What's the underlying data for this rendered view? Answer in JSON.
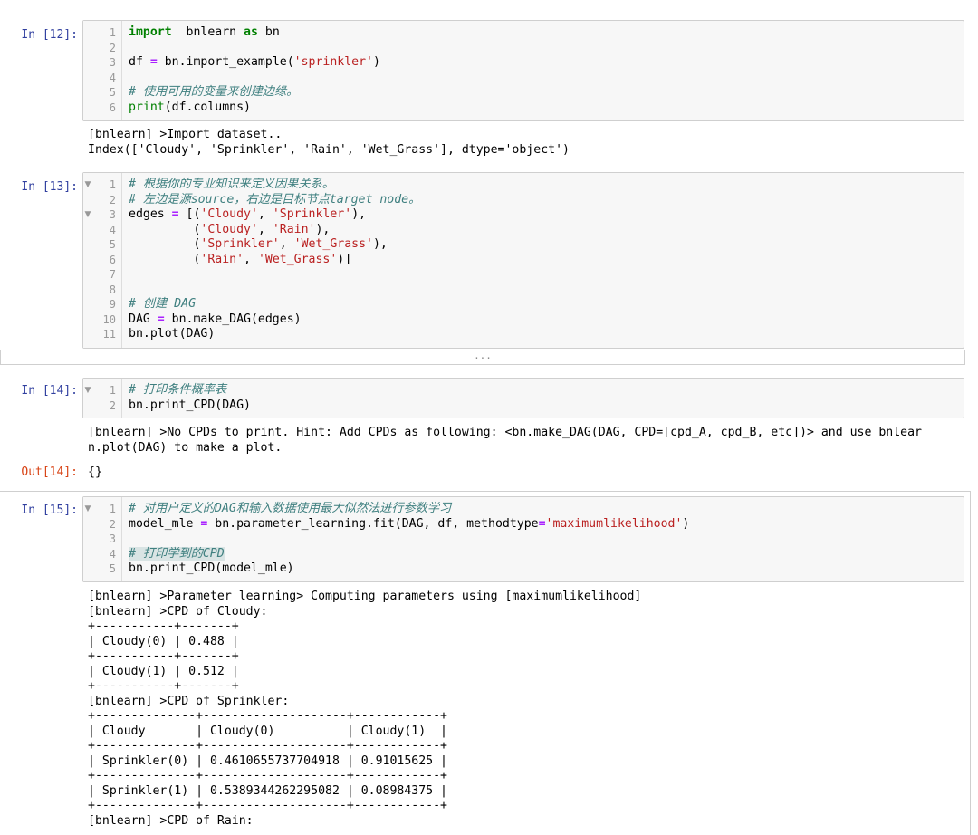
{
  "cells": [
    {
      "prompt": "In [12]:",
      "lines": [
        {
          "n": "1",
          "fold": "",
          "segs": [
            [
              "kw",
              "import"
            ],
            [
              "",
              "  bnlearn "
            ],
            [
              "kw",
              "as"
            ],
            [
              "",
              " bn"
            ]
          ]
        },
        {
          "n": "2",
          "fold": "",
          "segs": []
        },
        {
          "n": "3",
          "fold": "",
          "segs": [
            [
              "",
              "df "
            ],
            [
              "op",
              "="
            ],
            [
              "",
              " bn.import_example("
            ],
            [
              "str",
              "'sprinkler'"
            ],
            [
              "",
              ")"
            ]
          ]
        },
        {
          "n": "4",
          "fold": "",
          "segs": []
        },
        {
          "n": "5",
          "fold": "",
          "segs": [
            [
              "cm",
              "# 使用可用的变量来创建边缘。"
            ]
          ]
        },
        {
          "n": "6",
          "fold": "",
          "segs": [
            [
              "bi",
              "print"
            ],
            [
              "",
              "(df.columns)"
            ]
          ]
        }
      ],
      "output": "[bnlearn] >Import dataset..\nIndex(['Cloudy', 'Sprinkler', 'Rain', 'Wet_Grass'], dtype='object')"
    },
    {
      "prompt": "In [13]:",
      "lines": [
        {
          "n": "1",
          "fold": "▼",
          "segs": [
            [
              "cm",
              "# 根据你的专业知识来定义因果关系。"
            ]
          ]
        },
        {
          "n": "2",
          "fold": "",
          "segs": [
            [
              "cm",
              "# 左边是源source，右边是目标节点target node。"
            ]
          ]
        },
        {
          "n": "3",
          "fold": "▼",
          "segs": [
            [
              "",
              "edges "
            ],
            [
              "op",
              "="
            ],
            [
              "",
              " [("
            ],
            [
              "str",
              "'Cloudy'"
            ],
            [
              "",
              ", "
            ],
            [
              "str",
              "'Sprinkler'"
            ],
            [
              "",
              "),"
            ]
          ]
        },
        {
          "n": "4",
          "fold": "",
          "segs": [
            [
              "",
              "         ("
            ],
            [
              "str",
              "'Cloudy'"
            ],
            [
              "",
              ", "
            ],
            [
              "str",
              "'Rain'"
            ],
            [
              "",
              "),"
            ]
          ]
        },
        {
          "n": "5",
          "fold": "",
          "segs": [
            [
              "",
              "         ("
            ],
            [
              "str",
              "'Sprinkler'"
            ],
            [
              "",
              ", "
            ],
            [
              "str",
              "'Wet_Grass'"
            ],
            [
              "",
              "),"
            ]
          ]
        },
        {
          "n": "6",
          "fold": "",
          "segs": [
            [
              "",
              "         ("
            ],
            [
              "str",
              "'Rain'"
            ],
            [
              "",
              ", "
            ],
            [
              "str",
              "'Wet_Grass'"
            ],
            [
              "",
              ")]"
            ]
          ]
        },
        {
          "n": "7",
          "fold": "",
          "segs": []
        },
        {
          "n": "8",
          "fold": "",
          "segs": []
        },
        {
          "n": "9",
          "fold": "",
          "segs": [
            [
              "cm",
              "# 创建 DAG"
            ]
          ]
        },
        {
          "n": "10",
          "fold": "",
          "segs": [
            [
              "",
              "DAG "
            ],
            [
              "op",
              "="
            ],
            [
              "",
              " bn.make_DAG(edges)"
            ]
          ]
        },
        {
          "n": "11",
          "fold": "",
          "segs": [
            [
              "",
              "bn.plot(DAG)"
            ]
          ]
        }
      ],
      "collapsed_marker": "..."
    },
    {
      "prompt": "In [14]:",
      "lines": [
        {
          "n": "1",
          "fold": "▼",
          "segs": [
            [
              "cm",
              "# 打印条件概率表"
            ]
          ]
        },
        {
          "n": "2",
          "fold": "",
          "segs": [
            [
              "",
              "bn.print_CPD(DAG)"
            ]
          ]
        }
      ],
      "output": "[bnlearn] >No CPDs to print. Hint: Add CPDs as following: <bn.make_DAG(DAG, CPD=[cpd_A, cpd_B, etc])> and use bnlear\nn.plot(DAG) to make a plot.",
      "out_prompt": "Out[14]:",
      "out_value": "{}"
    },
    {
      "prompt": "In [15]:",
      "lines": [
        {
          "n": "1",
          "fold": "▼",
          "segs": [
            [
              "cm",
              "# 对用户定义的DAG和输入数据使用最大似然法进行参数学习"
            ]
          ]
        },
        {
          "n": "2",
          "fold": "",
          "segs": [
            [
              "",
              "model_mle "
            ],
            [
              "op",
              "="
            ],
            [
              "",
              " bn.parameter_learning.fit(DAG, df, methodtype"
            ],
            [
              "op",
              "="
            ],
            [
              "str",
              "'maximumlikelihood'"
            ],
            [
              "",
              ")"
            ]
          ]
        },
        {
          "n": "3",
          "fold": "",
          "segs": []
        },
        {
          "n": "4",
          "fold": "",
          "segs": [
            [
              "cm hl",
              "# 打印学到的CPD"
            ]
          ]
        },
        {
          "n": "5",
          "fold": "",
          "segs": [
            [
              "",
              "bn.print_CPD(model_mle)"
            ]
          ]
        }
      ],
      "output": "[bnlearn] >Parameter learning> Computing parameters using [maximumlikelihood]\n[bnlearn] >CPD of Cloudy:\n+-----------+-------+\n| Cloudy(0) | 0.488 |\n+-----------+-------+\n| Cloudy(1) | 0.512 |\n+-----------+-------+\n[bnlearn] >CPD of Sprinkler:\n+--------------+--------------------+------------+\n| Cloudy       | Cloudy(0)          | Cloudy(1)  |\n+--------------+--------------------+------------+\n| Sprinkler(0) | 0.4610655737704918 | 0.91015625 |\n+--------------+--------------------+------------+\n| Sprinkler(1) | 0.5389344262295082 | 0.08984375 |\n+--------------+--------------------+------------+\n[bnlearn] >CPD of Rain:"
    }
  ]
}
